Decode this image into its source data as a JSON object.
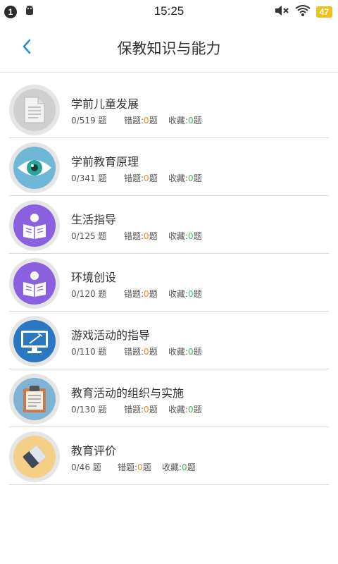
{
  "status_bar": {
    "notification_count": "1",
    "time": "15:25",
    "battery": "47"
  },
  "header": {
    "title": "保教知识与能力"
  },
  "items": [
    {
      "name": "学前儿童发展",
      "progress": "0/519 题",
      "wrong_label": "错题:",
      "wrong_count": "0",
      "wrong_unit": "题",
      "fav_label": "收藏:",
      "fav_count": "0",
      "fav_unit": "题",
      "icon": "document-icon"
    },
    {
      "name": "学前教育原理",
      "progress": "0/341 题",
      "wrong_label": "错题:",
      "wrong_count": "0",
      "wrong_unit": "题",
      "fav_label": "收藏:",
      "fav_count": "0",
      "fav_unit": "题",
      "icon": "eye-icon"
    },
    {
      "name": "生活指导",
      "progress": "0/125 题",
      "wrong_label": "错题:",
      "wrong_count": "0",
      "wrong_unit": "题",
      "fav_label": "收藏:",
      "fav_count": "0",
      "fav_unit": "题",
      "icon": "reader-icon"
    },
    {
      "name": "环境创设",
      "progress": "0/120 题",
      "wrong_label": "错题:",
      "wrong_count": "0",
      "wrong_unit": "题",
      "fav_label": "收藏:",
      "fav_count": "0",
      "fav_unit": "题",
      "icon": "reader-icon"
    },
    {
      "name": "游戏活动的指导",
      "progress": "0/110 题",
      "wrong_label": "错题:",
      "wrong_count": "0",
      "wrong_unit": "题",
      "fav_label": "收藏:",
      "fav_count": "0",
      "fav_unit": "题",
      "icon": "monitor-icon"
    },
    {
      "name": "教育活动的组织与实施",
      "progress": "0/130 题",
      "wrong_label": "错题:",
      "wrong_count": "0",
      "wrong_unit": "题",
      "fav_label": "收藏:",
      "fav_count": "0",
      "fav_unit": "题",
      "icon": "clipboard-icon"
    },
    {
      "name": "教育评价",
      "progress": "0/46 题",
      "wrong_label": "错题:",
      "wrong_count": "0",
      "wrong_unit": "题",
      "fav_label": "收藏:",
      "fav_count": "0",
      "fav_unit": "题",
      "icon": "eraser-icon"
    }
  ],
  "colors": {
    "accent": "#1f8fe0",
    "wrong_count": "#f08a24",
    "fav_count": "#3dbb5b",
    "divider": "#d9d9d9"
  }
}
